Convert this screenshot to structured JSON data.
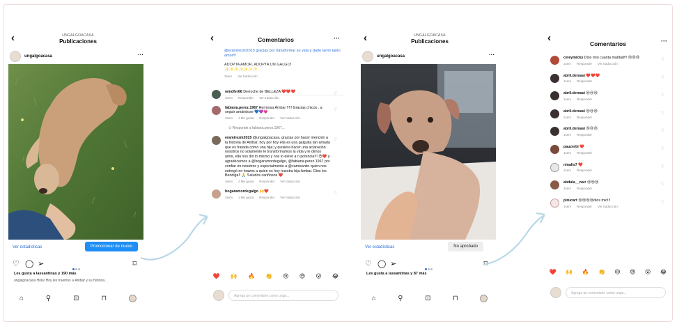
{
  "screen1": {
    "account_small": "UNGALGOACASA",
    "title": "Publicaciones",
    "username": "ungalgoacasa",
    "stats_link": "Ver estadísticas",
    "promote_button": "Promocionar de nuevo",
    "likes_text": "Les gusta a lassantinas y 190 más",
    "caption": "ungalgoacasa Hola! Hoy les traemos a Ámbar y su historia..."
  },
  "screen2": {
    "title": "Comentarios",
    "caption_text": "@eramirezm2015 gracias por transformar su vida y darle tanto tanto amor!!!",
    "caption_adopt": "ADOPTA AMOR, ADOPTA UN GALGO!",
    "caption_emojis": "✨✨✨✨✨✨✨",
    "caption_meta_time": "3sem",
    "caption_meta_translate": "Ver traducción",
    "comments": [
      {
        "user": "windfer66",
        "text": "Derroche de BELLEZA ❤️❤️❤️",
        "time": "3sem",
        "likes": "",
        "reply": "Responder",
        "translate": "Ver traducción"
      },
      {
        "user": "fabiana.perez.1967",
        "text": "Hermosa Ámbar !!!!! Gracias chicos , a seguir amándose 💙💜💗",
        "time": "3sem",
        "likes": "1 Me gusta",
        "reply": "Responder",
        "translate": "Ver traducción"
      },
      {
        "user": "eramirezm2015",
        "text": "@ungalgoacasa, gracias por hacer mención a la historia de Ambar, hoy por hoy ella es una galguita tan amada que es tratada como una hija; y quisiera hacer una aclaración nosotros no solamente le transformamos la vida y le dimos amor, ella nos dió lo mismo y nos lo elevó a n potencia!!! 😍❤️ y agradecemos a @hogaramordegalgo, @fabiana.perez.1967 por confiar en nosotros y especialmente a @camisantin quien nos entregó en brazos a quien es hoy nuestra hija Ambar. Dios los Bendiga!! 🙏 Saludos cariñosos ❤️",
        "time": "3sem",
        "likes": "2 Me gusta",
        "reply": "Responder",
        "translate": "Ver traducción"
      },
      {
        "user": "hogaramordegalgo",
        "text": "🙌❤️",
        "time": "3sem",
        "likes": "1 Me gusta",
        "reply": "Responder",
        "translate": "Ver traducción"
      }
    ],
    "reply_line": "Responde a fabiana.perez.1967...",
    "input_placeholder": "Agrega un comentario como unga..."
  },
  "screen3": {
    "account_small": "UNGALGOACASA",
    "title": "Publicaciones",
    "username": "ungalgoacasa",
    "stats_link": "Ver estadísticas",
    "status_button": "No aprobado",
    "likes_text": "Les gusta a lassantinas y 87 más"
  },
  "screen4": {
    "title": "Comentarios",
    "comments": [
      {
        "user": "celeymicky",
        "text": "Dios mío cuanta maldad!!! 😢😢😢",
        "time": "1sem",
        "reply": "Responder",
        "translate": "Ver traducción"
      },
      {
        "user": "abril.demasi",
        "text": "❤️❤️❤️",
        "time": "1sem",
        "reply": "Responder",
        "translate": ""
      },
      {
        "user": "abril.demasi",
        "text": "😢😢😢",
        "time": "1sem",
        "reply": "Responder",
        "translate": ""
      },
      {
        "user": "abril.demasi",
        "text": "😢😢😢",
        "time": "1sem",
        "reply": "Responder",
        "translate": ""
      },
      {
        "user": "abril.demasi",
        "text": "😢😢😢",
        "time": "1sem",
        "reply": "Responder",
        "translate": ""
      },
      {
        "user": "pauzerbi",
        "text": "❤️",
        "time": "1sem",
        "reply": "Responder",
        "translate": ""
      },
      {
        "user": "ninalis7",
        "text": "❤️",
        "time": "1sem",
        "reply": "Responder",
        "translate": ""
      },
      {
        "user": "abdala__nair",
        "text": "😢😢😢",
        "time": "1sem",
        "reply": "Responder",
        "translate": ""
      },
      {
        "user": "pirucart",
        "text": "😢😢😢😢dios mio!!!",
        "time": "1sem",
        "reply": "Responder",
        "translate": "Ver traducción"
      }
    ],
    "input_placeholder": "Agrega un comentario como unga..."
  },
  "emoji_bar": [
    "❤️",
    "🙌",
    "🔥",
    "👏",
    "😢",
    "😍",
    "😮",
    "😂"
  ],
  "colors": {
    "accent": "#1d8ef5",
    "link": "#2a6fd6",
    "arrow": "#b9d8e6"
  }
}
